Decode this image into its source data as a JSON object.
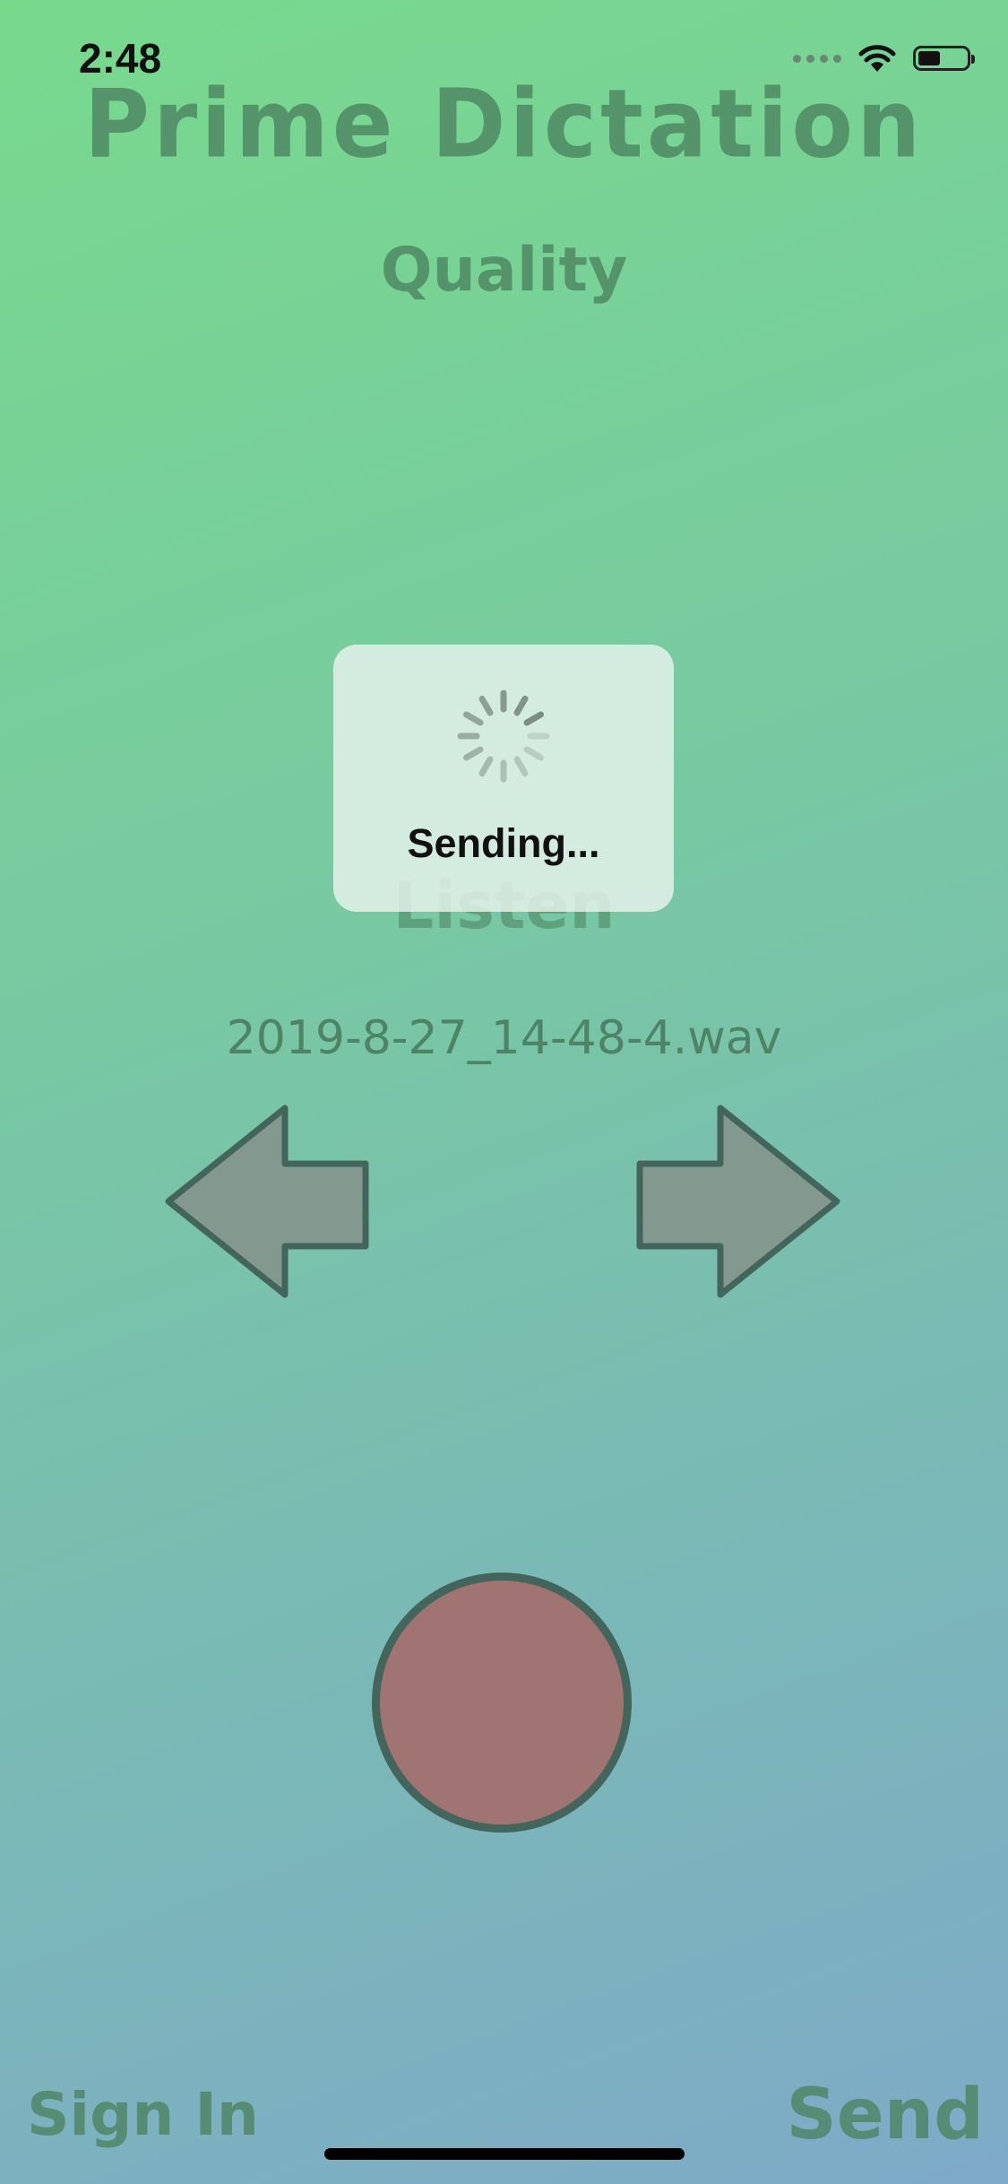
{
  "status_bar": {
    "time": "2:48"
  },
  "app": {
    "title": "Prime Dictation",
    "quality_label": "Quality",
    "listen_label": "Listen",
    "filename": "2019-8-27_14-48-4.wav"
  },
  "footer": {
    "sign_in_label": "Sign In",
    "send_label": "Send"
  },
  "hud": {
    "label": "Sending..."
  },
  "colors": {
    "record_button": "#a07472",
    "arrow_fill": "#83998f",
    "outline": "#44655c",
    "text": "#4b825f"
  },
  "icons": {
    "previous": "arrow-left-icon",
    "next": "arrow-right-icon",
    "spinner": "activity-spinner-icon",
    "wifi": "wifi-icon",
    "battery": "battery-icon"
  }
}
